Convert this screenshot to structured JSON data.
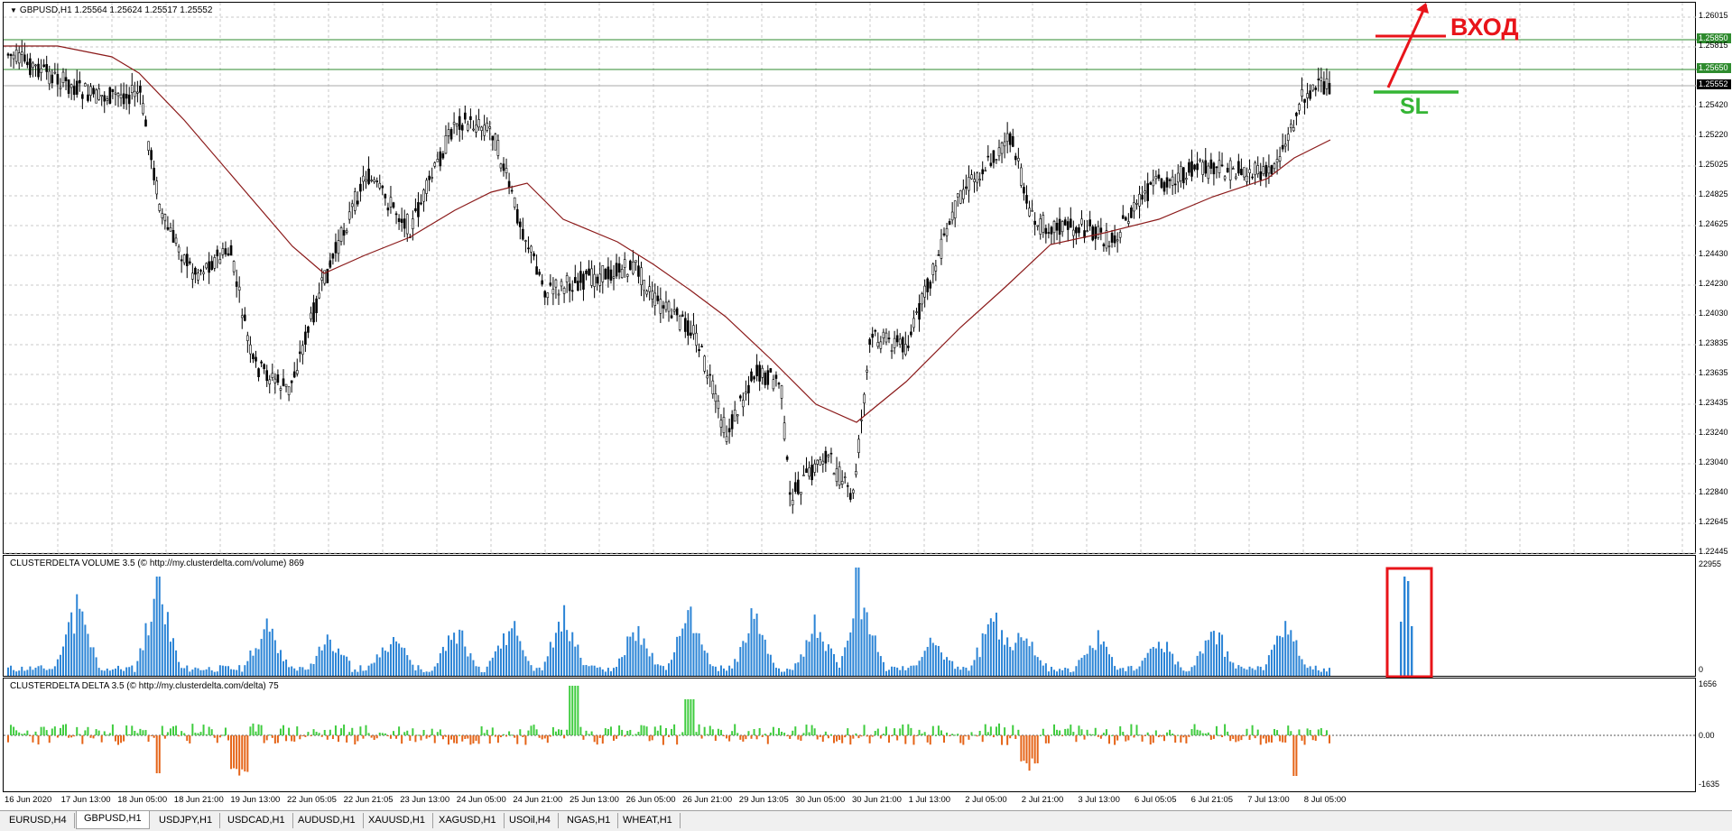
{
  "chart": {
    "title": "GBPUSD,H1  1.25564 1.25624 1.25517 1.25552",
    "price_labels": [
      "1.26015",
      "1.25815",
      "1.25420",
      "1.25220",
      "1.25025",
      "1.24825",
      "1.24625",
      "1.24430",
      "1.24230",
      "1.24030",
      "1.23835",
      "1.23635",
      "1.23435",
      "1.23240",
      "1.23040",
      "1.22840",
      "1.22645",
      "1.22445"
    ],
    "level_tags": {
      "upper": "1.25850",
      "middle": "1.25650",
      "current": "1.25552"
    },
    "entry_label": "ВХОД",
    "sl_label": "SL",
    "colors": {
      "level_line": "#2e8b2e",
      "ma_line": "#8b1a1a",
      "annotation_red": "#e8141a",
      "sl_green": "#35b535",
      "volume_bar": "#2b84d6",
      "delta_up": "#3fcc3f",
      "delta_down": "#e56418"
    }
  },
  "volume": {
    "header": "CLUSTERDELTA VOLUME 3.5 (© http://my.clusterdelta.com/volume) 869",
    "scale_top": "22955",
    "scale_bottom": "0"
  },
  "delta": {
    "header": "CLUSTERDELTA DELTA 3.5 (© http://my.clusterdelta.com/delta) 75",
    "scale_top": "1656",
    "scale_zero": "0.00",
    "scale_bottom": "-1635"
  },
  "time_labels": [
    "16 Jun 2020",
    "17 Jun 13:00",
    "18 Jun 05:00",
    "18 Jun 21:00",
    "19 Jun 13:00",
    "22 Jun 05:05",
    "22 Jun 21:05",
    "23 Jun 13:00",
    "24 Jun 05:00",
    "24 Jun 21:00",
    "25 Jun 13:00",
    "26 Jun 05:00",
    "26 Jun 21:00",
    "29 Jun 13:05",
    "30 Jun 05:00",
    "30 Jun 21:00",
    "1 Jul 13:00",
    "2 Jul 05:00",
    "2 Jul 21:00",
    "3 Jul 13:00",
    "6 Jul 05:05",
    "6 Jul 21:05",
    "7 Jul 13:00",
    "8 Jul 05:00"
  ],
  "tabs": [
    "EURUSD,H4",
    "GBPUSD,H1",
    "USDJPY,H1",
    "USDCAD,H1",
    "AUDUSD,H1",
    "XAUUSD,H1",
    "XAGUSD,H1",
    "USOil,H4",
    "NGAS,H1",
    "WHEAT,H1"
  ],
  "active_tab": "GBPUSD,H1"
}
